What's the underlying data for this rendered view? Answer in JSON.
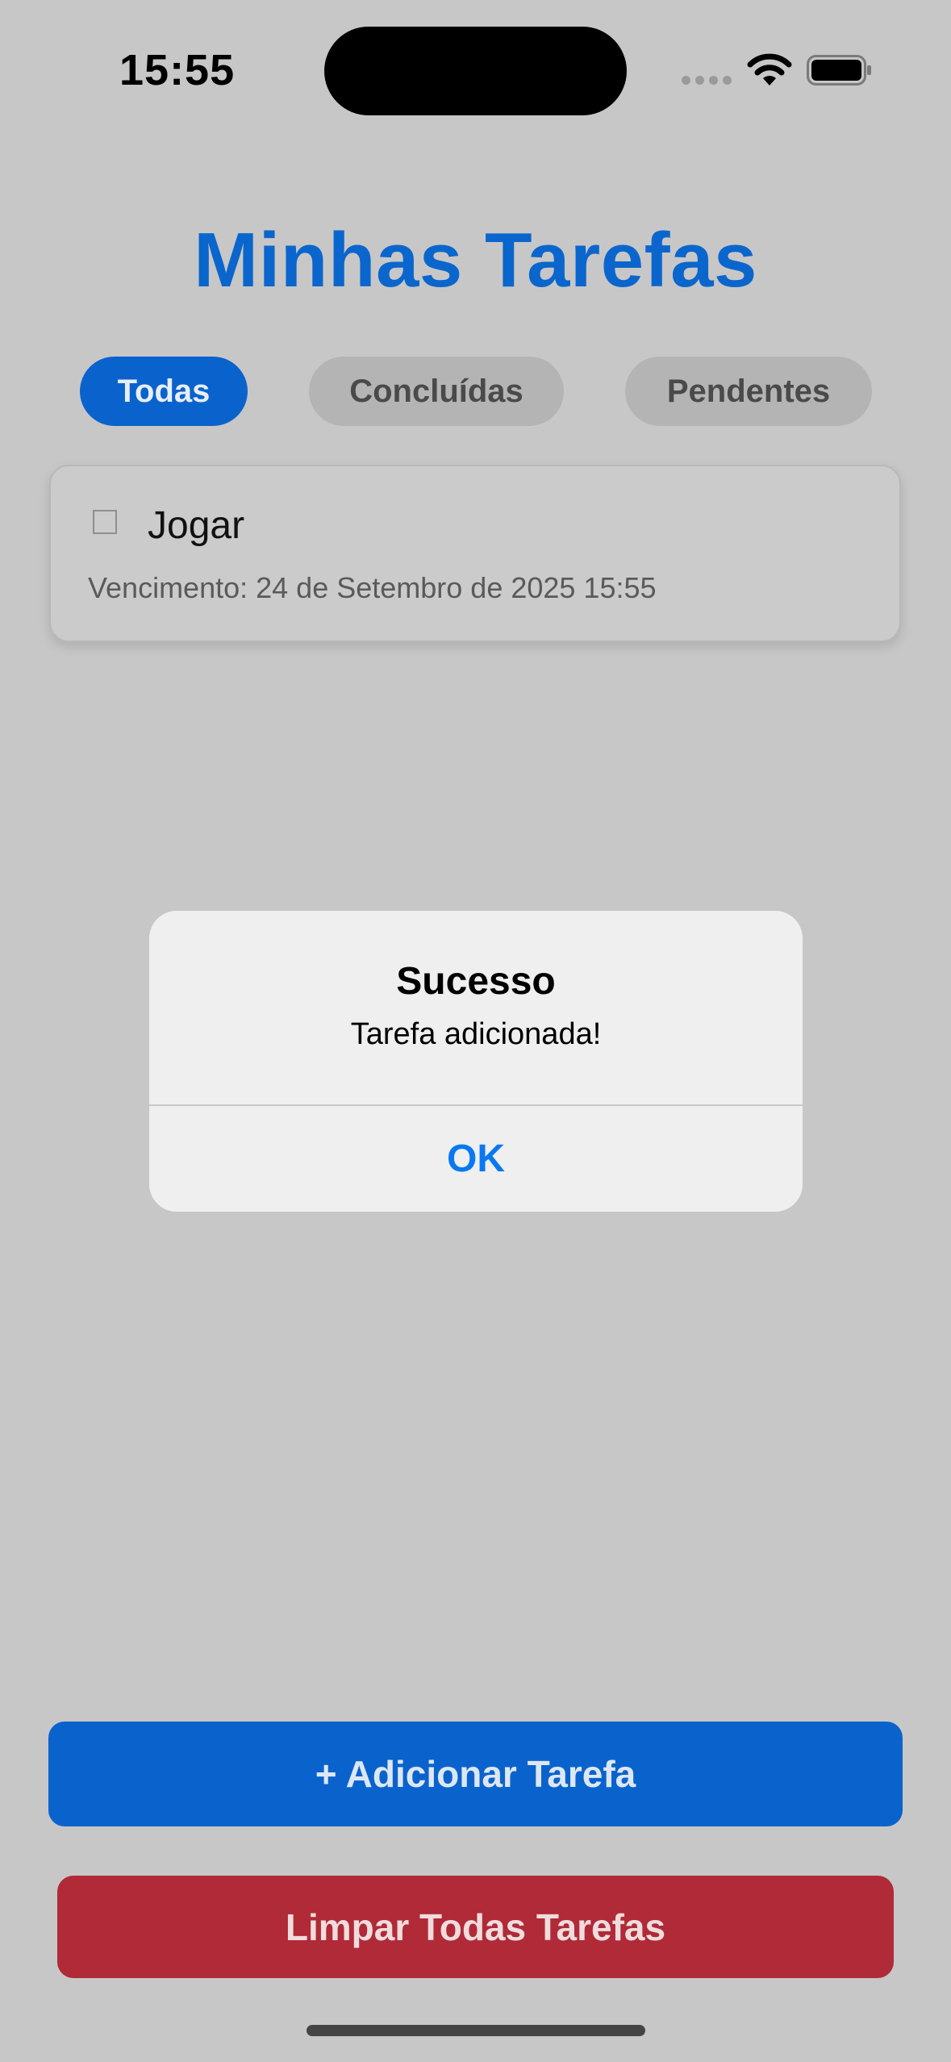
{
  "status_bar": {
    "time": "15:55"
  },
  "header": {
    "title": "Minhas Tarefas"
  },
  "filters": {
    "tabs": [
      {
        "label": "Todas",
        "active": true
      },
      {
        "label": "Concluídas",
        "active": false
      },
      {
        "label": "Pendentes",
        "active": false
      }
    ]
  },
  "tasks": [
    {
      "title": "Jogar",
      "due": "Vencimento: 24 de Setembro de 2025 15:55",
      "completed": false
    }
  ],
  "alert": {
    "title": "Sucesso",
    "message": "Tarefa adicionada!",
    "ok_label": "OK"
  },
  "actions": {
    "add_label": "+ Adicionar Tarefa",
    "clear_label": "Limpar Todas Tarefas"
  },
  "colors": {
    "primary": "#0a63cc",
    "danger": "#b02a37",
    "alert_link": "#0a78f0",
    "background": "#c7c7c8"
  }
}
